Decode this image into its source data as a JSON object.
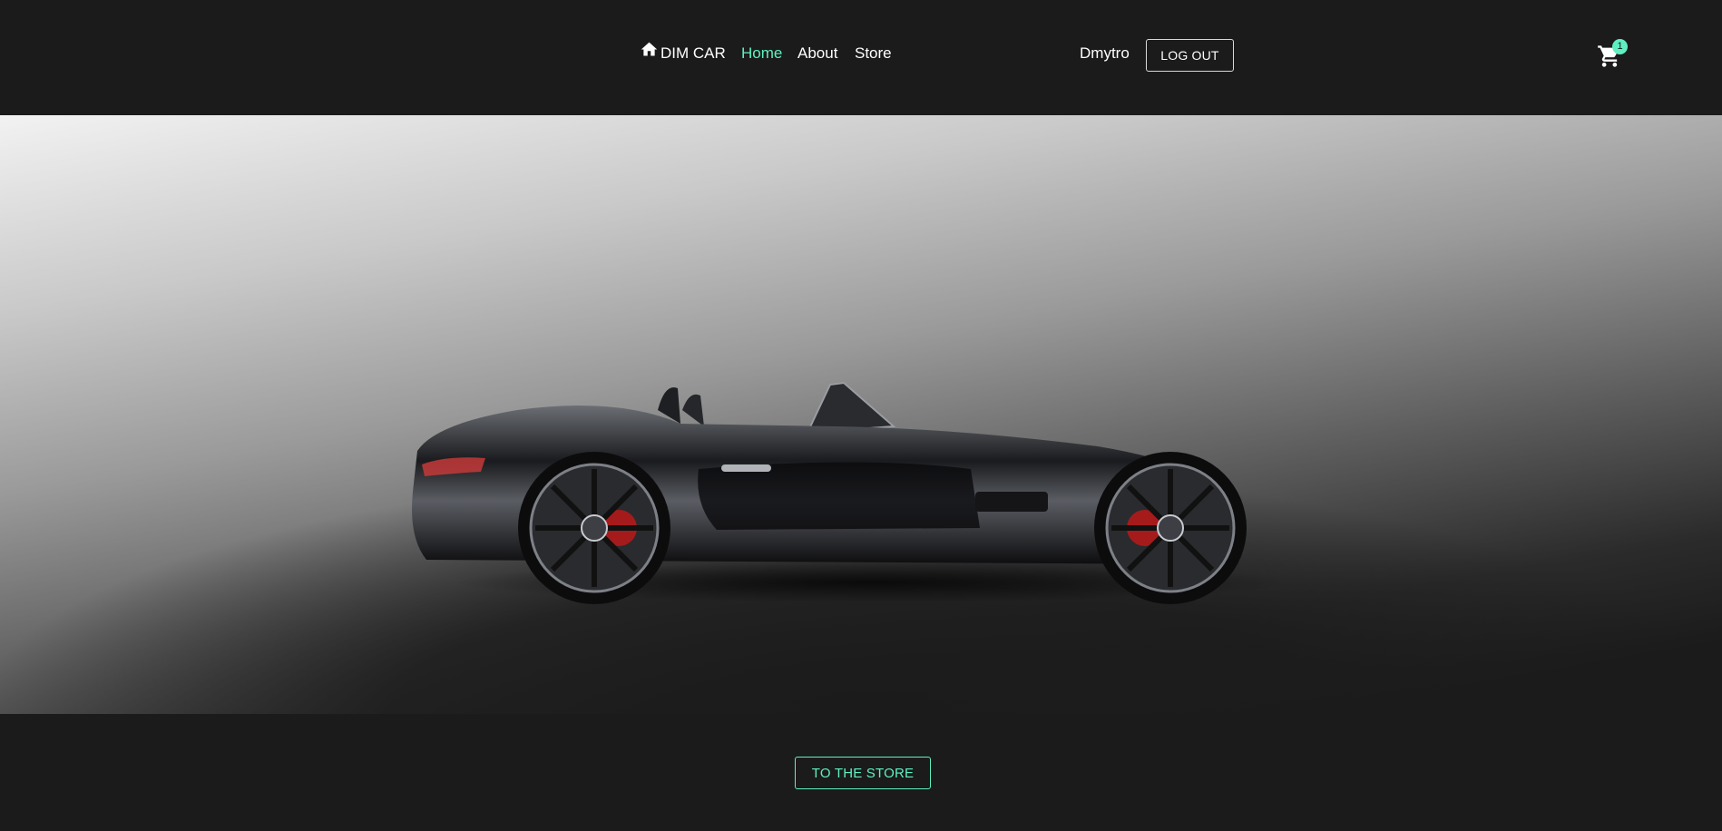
{
  "nav": {
    "brand": "DIM CAR",
    "brand_icon": "home-icon",
    "links": [
      {
        "label": "Home",
        "active": true
      },
      {
        "label": "About",
        "active": false
      },
      {
        "label": "Store",
        "active": false
      }
    ]
  },
  "user": {
    "name": "Dmytro",
    "logout_label": "LOG OUT"
  },
  "cart": {
    "icon": "cart-icon",
    "count": "1"
  },
  "hero": {
    "image": "black convertible sports car, side view"
  },
  "cta": {
    "label": "TO THE STORE"
  },
  "colors": {
    "background": "#1b1b1b",
    "accent": "#5ff0c2",
    "text": "#ffffff"
  }
}
